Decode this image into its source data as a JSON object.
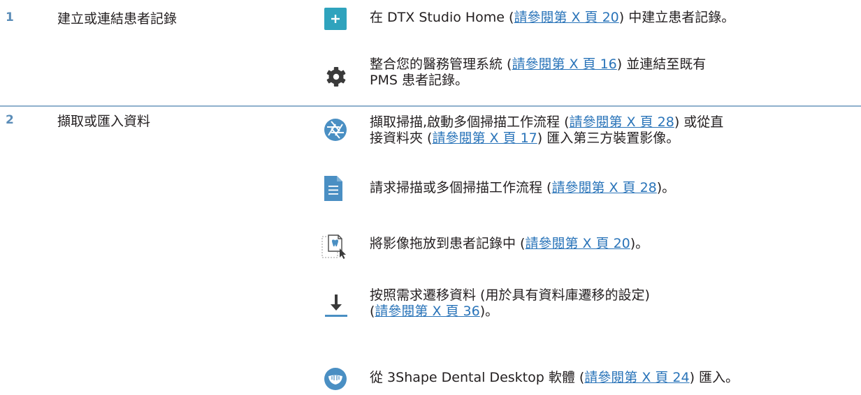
{
  "steps": [
    {
      "number": "1",
      "title": "建立或連結患者記錄",
      "items": [
        {
          "icon": "plus-icon",
          "lines": [
            {
              "pre": "在 DTX Studio Home (",
              "link": "請參閱第 X 頁 20",
              "post": ") 中建立患者記錄。"
            }
          ]
        },
        {
          "icon": "gear-icon",
          "lines": [
            {
              "pre": "整合您的醫務管理系統 (",
              "link": "請參閱第 X 頁 16",
              "post": ") 並連結至既有"
            },
            {
              "pre": "PMS 患者記錄。",
              "link": "",
              "post": ""
            }
          ]
        }
      ]
    },
    {
      "number": "2",
      "title": "擷取或匯入資料",
      "items": [
        {
          "icon": "aperture-icon",
          "lines": [
            {
              "pre": "擷取掃描,啟動多個掃描工作流程 (",
              "link": "請參閱第 X 頁 28",
              "post": ") 或從直"
            },
            {
              "pre": "接資料夾 (",
              "link": "請參閱第 X 頁 17",
              "post": ") 匯入第三方裝置影像。"
            }
          ]
        },
        {
          "icon": "document-icon",
          "lines": [
            {
              "pre": "請求掃描或多個掃描工作流程 (",
              "link": "請參閱第 X 頁 28",
              "post": ")。"
            }
          ]
        },
        {
          "icon": "drag-drop-image-icon",
          "lines": [
            {
              "pre": "將影像拖放到患者記錄中 (",
              "link": "請參閱第 X 頁 20",
              "post": ")。"
            }
          ]
        },
        {
          "icon": "download-icon",
          "lines": [
            {
              "pre": "按照需求遷移資料 (用於具有資料庫遷移的設定)",
              "link": "",
              "post": ""
            },
            {
              "pre": "(",
              "link": "請參閱第 X 頁 36",
              "post": ")。"
            }
          ]
        },
        {
          "icon": "intraoral-scan-icon",
          "lines": [
            {
              "pre": "從 3Shape Dental Desktop 軟體 (",
              "link": "請參閱第 X 頁 24",
              "post": ") 匯入。"
            }
          ]
        }
      ]
    }
  ],
  "colors": {
    "accent_blue": "#4a8fc3",
    "teal": "#2fa3bd",
    "link": "#2a74b9",
    "divider": "#8eb0cc",
    "number": "#5b8db8"
  }
}
